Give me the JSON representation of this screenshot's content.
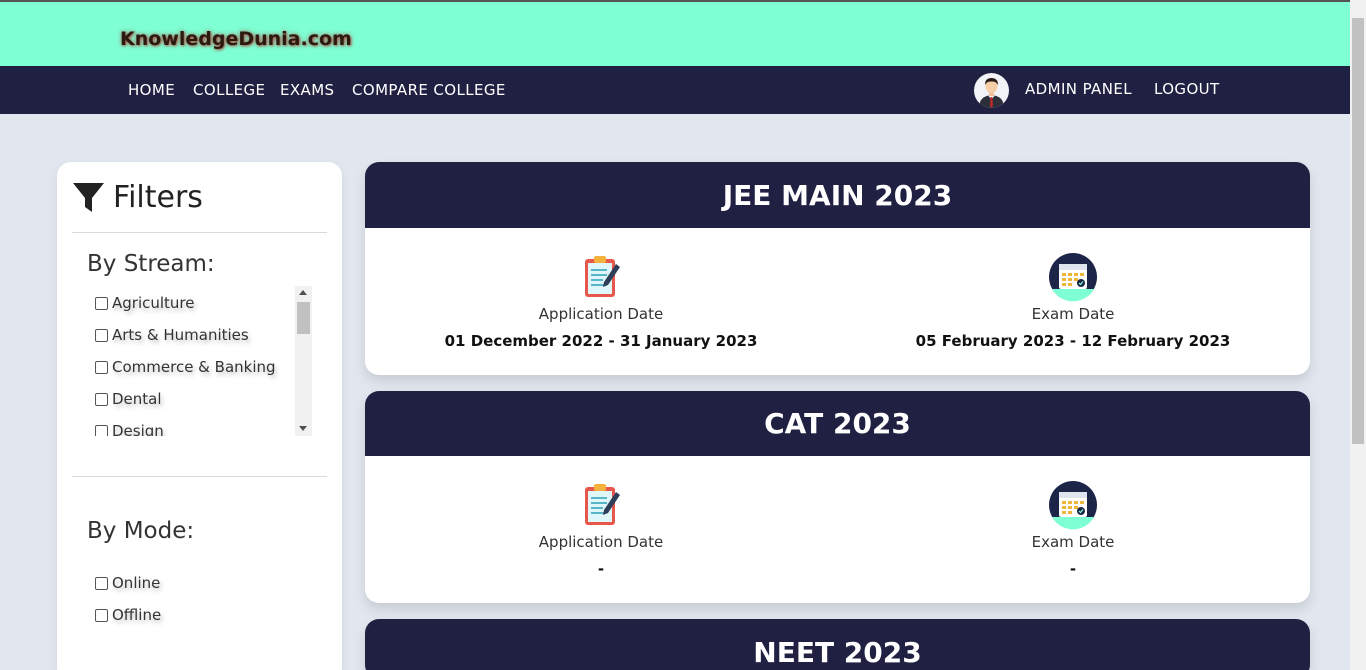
{
  "brand": "KnowledgeDunia.com",
  "nav": {
    "left": [
      "HOME",
      "COLLEGE",
      "EXAMS",
      "COMPARE COLLEGE"
    ],
    "admin": "ADMIN PANEL",
    "logout": "LOGOUT"
  },
  "filters": {
    "title": "Filters",
    "stream_title": "By Stream:",
    "streams": [
      "Agriculture",
      "Arts & Humanities",
      "Commerce & Banking",
      "Dental",
      "Design"
    ],
    "mode_title": "By Mode:",
    "modes": [
      "Online",
      "Offline"
    ]
  },
  "exams": [
    {
      "name": "JEE MAIN 2023",
      "app_label": "Application Date",
      "app_value": "01 December 2022 - 31 January 2023",
      "exam_label": "Exam Date",
      "exam_value": "05 February 2023 - 12 February 2023"
    },
    {
      "name": "CAT 2023",
      "app_label": "Application Date",
      "app_value": "-",
      "exam_label": "Exam Date",
      "exam_value": "-"
    },
    {
      "name": "NEET 2023"
    }
  ],
  "colors": {
    "topbar": "#7fffd4",
    "nav": "#202043",
    "background": "#e2e7ef"
  }
}
